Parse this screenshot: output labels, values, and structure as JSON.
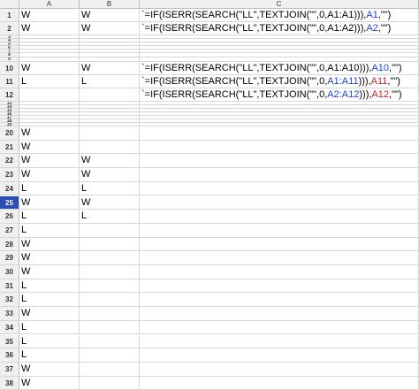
{
  "columns": [
    "A",
    "B",
    "C"
  ],
  "rows": [
    {
      "n": "1",
      "a": "W",
      "b": "W",
      "c": {
        "pre": "`=IF(ISERR(SEARCH(\"LL\",TEXTJOIN(\"\",0,",
        "r1": "A1:A1",
        "mid": "))),",
        "r2": "A1",
        "post": ",\"\")"
      }
    },
    {
      "n": "2",
      "a": "W",
      "b": "W",
      "c": {
        "pre": "`=IF(ISERR(SEARCH(\"LL\",TEXTJOIN(\"\",0,",
        "r1": "A1:A2",
        "mid": "))),",
        "r2": "A2",
        "post": ",\"\")"
      }
    },
    {
      "n": "3",
      "a": "",
      "b": ""
    },
    {
      "n": "4",
      "a": "",
      "b": ""
    },
    {
      "n": "5",
      "a": "",
      "b": ""
    },
    {
      "n": "6",
      "a": "",
      "b": ""
    },
    {
      "n": "7",
      "a": "",
      "b": ""
    },
    {
      "n": "8",
      "a": "",
      "b": ""
    },
    {
      "n": "9",
      "a": "",
      "b": ""
    },
    {
      "n": "10",
      "a": "W",
      "b": "W",
      "c": {
        "pre": "`=IF(ISERR(SEARCH(\"LL\",TEXTJOIN(\"\",0,",
        "r1": "A1:A10",
        "mid": "))),",
        "r2": "A10",
        "post": ",\"\")"
      }
    },
    {
      "n": "11",
      "a": "L",
      "b": "L",
      "c": {
        "pre": "`=IF(ISERR(SEARCH(\"LL\",TEXTJOIN(\"\",0,",
        "r1": "A1:A11",
        "mid": "))),",
        "r2": "A11",
        "post": ",\"\")"
      }
    },
    {
      "n": "12",
      "a": "",
      "b": "",
      "c": {
        "pre": "`=IF(ISERR(SEARCH(\"LL\",TEXTJOIN(\"\",0,",
        "r1": "A2:A12",
        "mid": "))),",
        "r2": "A12",
        "post": ",\"\")"
      }
    },
    {
      "n": "13",
      "a": "",
      "b": ""
    },
    {
      "n": "14",
      "a": "",
      "b": ""
    },
    {
      "n": "15",
      "a": "",
      "b": ""
    },
    {
      "n": "16",
      "a": "",
      "b": ""
    },
    {
      "n": "17",
      "a": "",
      "b": ""
    },
    {
      "n": "18",
      "a": "",
      "b": ""
    },
    {
      "n": "19",
      "a": "",
      "b": ""
    },
    {
      "n": "20",
      "a": "W",
      "b": ""
    },
    {
      "n": "21",
      "a": "W",
      "b": ""
    },
    {
      "n": "22",
      "a": "W",
      "b": "W"
    },
    {
      "n": "23",
      "a": "W",
      "b": "W"
    },
    {
      "n": "24",
      "a": "L",
      "b": "L"
    },
    {
      "n": "25",
      "a": "W",
      "b": "W"
    },
    {
      "n": "26",
      "a": "L",
      "b": "L"
    },
    {
      "n": "27",
      "a": "L",
      "b": ""
    },
    {
      "n": "28",
      "a": "W",
      "b": ""
    },
    {
      "n": "29",
      "a": "W",
      "b": ""
    },
    {
      "n": "30",
      "a": "W",
      "b": ""
    },
    {
      "n": "31",
      "a": "L",
      "b": ""
    },
    {
      "n": "32",
      "a": "L",
      "b": ""
    },
    {
      "n": "33",
      "a": "W",
      "b": ""
    },
    {
      "n": "34",
      "a": "L",
      "b": ""
    },
    {
      "n": "35",
      "a": "L",
      "b": ""
    },
    {
      "n": "36",
      "a": "L",
      "b": ""
    },
    {
      "n": "37",
      "a": "W",
      "b": ""
    },
    {
      "n": "38",
      "a": "W",
      "b": ""
    }
  ],
  "selected_row": "25",
  "colors": {
    "ref1": "#1f3fd6",
    "ref2": "#d02020",
    "row_selected": "#2a4fb0"
  }
}
